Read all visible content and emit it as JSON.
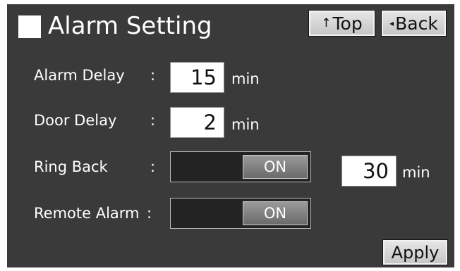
{
  "header": {
    "title": "Alarm Setting",
    "top_arrow": "↑",
    "top_label": "Top",
    "back_arrow": "◂",
    "back_label": "Back"
  },
  "rows": {
    "alarm_delay": {
      "label": "Alarm Delay",
      "colon": ":",
      "value": "15",
      "unit": "min"
    },
    "door_delay": {
      "label": "Door Delay",
      "colon": ":",
      "value": "2",
      "unit": "min"
    },
    "ring_back": {
      "label": "Ring Back",
      "colon": ":",
      "state": "ON",
      "value": "30",
      "unit": "min"
    },
    "remote_alarm": {
      "label": "Remote Alarm",
      "colon": ":",
      "state": "ON"
    }
  },
  "footer": {
    "apply_label": "Apply"
  }
}
